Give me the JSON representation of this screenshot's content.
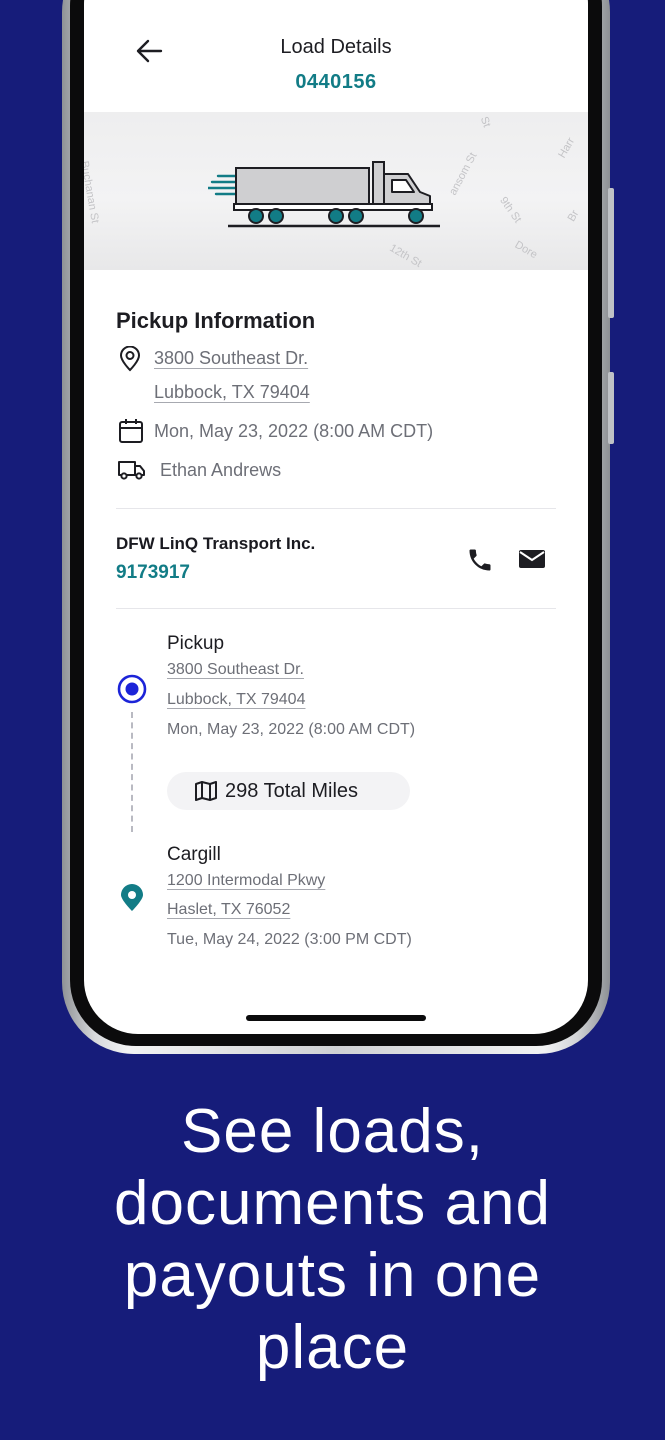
{
  "header": {
    "title": "Load Details",
    "load_id": "0440156"
  },
  "map": {
    "streets": [
      "Buchanan St",
      "St",
      "ansom St",
      "9th St",
      "Harr",
      "Br",
      "12th St",
      "Dore"
    ]
  },
  "pickup_info": {
    "title": "Pickup Information",
    "address_line1": "3800 Southeast Dr.",
    "address_line2": "Lubbock, TX 79404",
    "datetime": "Mon, May 23, 2022 (8:00 AM CDT)",
    "driver": "Ethan Andrews"
  },
  "carrier": {
    "name": "DFW LinQ Transport Inc.",
    "id": "9173917",
    "icons": [
      "phone-icon",
      "email-icon"
    ]
  },
  "route": {
    "pickup": {
      "name": "Pickup",
      "address_line1": "3800 Southeast Dr.",
      "address_line2": "Lubbock, TX 79404",
      "datetime": "Mon, May 23, 2022 (8:00 AM CDT)"
    },
    "total_miles": "298 Total Miles",
    "dropoff": {
      "name": "Cargill",
      "address_line1": "1200 Intermodal Pkwy",
      "address_line2": "Haslet, TX 76052",
      "datetime": "Tue, May 24, 2022 (3:00 PM CDT)"
    }
  },
  "colors": {
    "background": "#161c7a",
    "accent_teal": "#127c86",
    "pickup_blue": "#1c24d8"
  },
  "caption": {
    "line1": "See loads,",
    "line2": "documents and",
    "line3": "payouts in one",
    "line4": "place"
  }
}
